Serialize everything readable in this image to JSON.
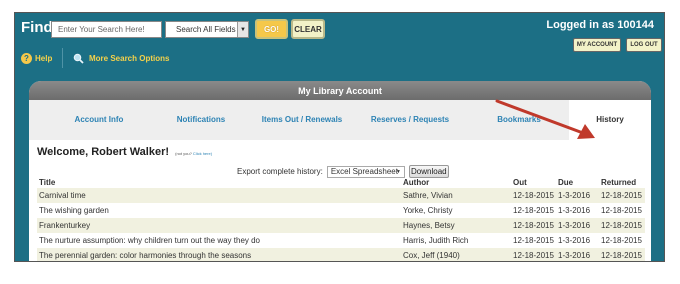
{
  "topbar": {
    "find_label": "Find:",
    "search_placeholder": "Enter Your Search Here!",
    "field_select_value": "Search All Fields",
    "go_label": "GO!",
    "clear_label": "CLEAR",
    "help_label": "Help",
    "more_options_label": "More Search Options",
    "logged_in_text": "Logged in as 100144",
    "my_account_label": "MY ACCOUNT",
    "logout_label": "LOG OUT"
  },
  "panel": {
    "title": "My Library Account",
    "tabs": [
      {
        "label": "Account Info",
        "active": false
      },
      {
        "label": "Notifications",
        "active": false
      },
      {
        "label": "Items Out / Renewals",
        "active": false
      },
      {
        "label": "Reserves / Requests",
        "active": false
      },
      {
        "label": "Bookmarks",
        "active": false
      },
      {
        "label": "History",
        "active": true
      }
    ]
  },
  "welcome": {
    "text": "Welcome, Robert Walker!",
    "not_you": "(not you?",
    "click_here": "Click here)"
  },
  "export": {
    "label": "Export complete history:",
    "format_value": "Excel Spreadsheet",
    "download_label": "Download"
  },
  "history_table": {
    "headers": {
      "title": "Title",
      "author": "Author",
      "out": "Out",
      "due": "Due",
      "returned": "Returned"
    },
    "rows": [
      {
        "title": "Carnival time",
        "author": "Sathre, Vivian",
        "out": "12-18-2015",
        "due": "1-3-2016",
        "returned": "12-18-2015"
      },
      {
        "title": "The wishing garden",
        "author": "Yorke, Christy",
        "out": "12-18-2015",
        "due": "1-3-2016",
        "returned": "12-18-2015"
      },
      {
        "title": "Frankenturkey",
        "author": "Haynes, Betsy",
        "out": "12-18-2015",
        "due": "1-3-2016",
        "returned": "12-18-2015"
      },
      {
        "title": "The nurture assumption: why children turn out the way they do",
        "author": "Harris, Judith Rich",
        "out": "12-18-2015",
        "due": "1-3-2016",
        "returned": "12-18-2015"
      },
      {
        "title": "The perennial garden: color harmonies through the seasons",
        "author": "Cox, Jeff (1940)",
        "out": "12-18-2015",
        "due": "1-3-2016",
        "returned": "12-18-2015"
      }
    ]
  },
  "colors": {
    "header_bg": "#1c6f85",
    "link_blue": "#2d83b4",
    "accent_yellow": "#f5c84a",
    "row_alt": "#f1f1e0",
    "arrow_red": "#c0392b"
  },
  "icons": {
    "help": "help-circle-icon",
    "search": "magnifier-icon",
    "arrow": "annotation-arrow-icon"
  }
}
